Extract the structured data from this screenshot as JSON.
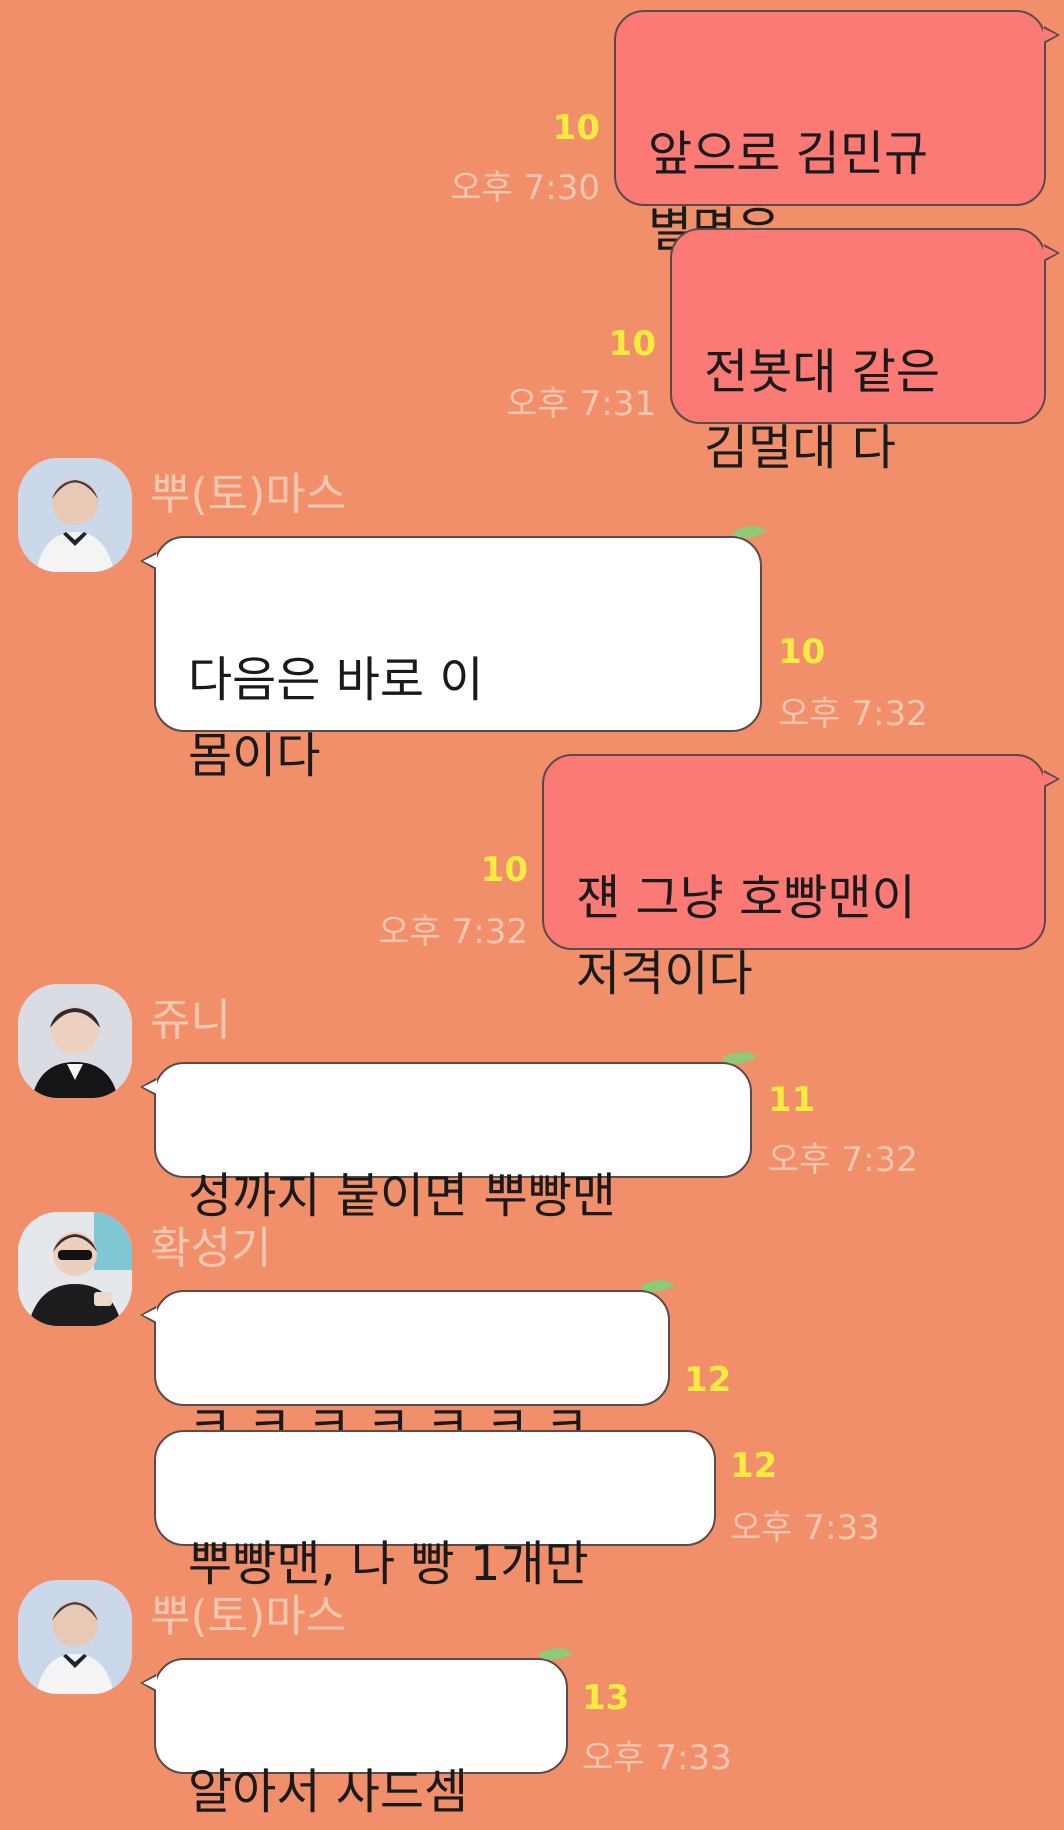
{
  "messages": [
    {
      "side": "me",
      "text": "앞으로 김민규\n별명은",
      "count": "10",
      "time": "오후 7:30"
    },
    {
      "side": "me",
      "text": "전봇대 같은\n김멀대 다",
      "count": "10",
      "time": "오후 7:31"
    },
    {
      "side": "other",
      "sender": "뿌(토)마스",
      "avatar_icon": "profile-avatar-icon",
      "text": "다음은 바로 이\n몸이다",
      "count": "10",
      "time": "오후 7:32"
    },
    {
      "side": "me",
      "text": "쟨 그냥 호빵맨이\n저격이다",
      "count": "10",
      "time": "오후 7:32"
    },
    {
      "side": "other",
      "sender": "쥬니",
      "avatar_icon": "profile-avatar-icon",
      "text": "성까지 붙이면 뿌빵맨",
      "count": "11",
      "time": "오후 7:32"
    },
    {
      "side": "other",
      "sender": "확성기",
      "avatar_icon": "profile-avatar-icon",
      "text": "ㅋ ㅋ ㅋ ㅋ ㅋ ㅋ ㅋ",
      "count": "12"
    },
    {
      "side": "other",
      "text": "뿌빵맨, 나 빵 1개만",
      "count": "12",
      "time": "오후 7:33"
    },
    {
      "side": "other",
      "sender": "뿌(토)마스",
      "avatar_icon": "profile-avatar-icon",
      "text": "알아서 사드셈",
      "count": "13",
      "time": "오후 7:33"
    }
  ],
  "colors": {
    "background": "#f28f6b",
    "my_bubble": "#fb7a76",
    "other_bubble": "#ffffff",
    "read_count": "#f7ec3f",
    "timestamp": "#f8c7b2"
  }
}
